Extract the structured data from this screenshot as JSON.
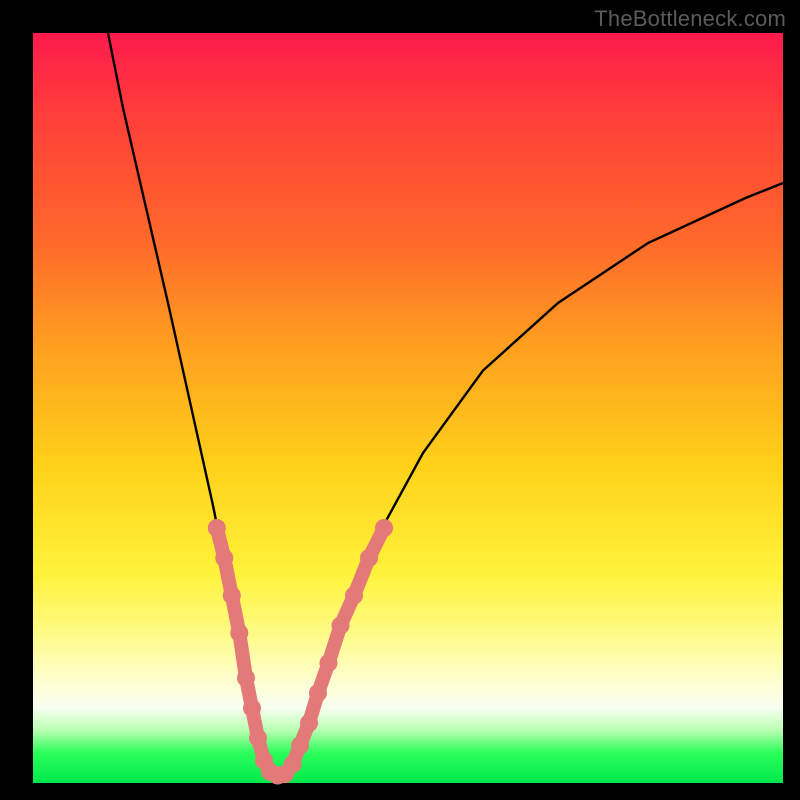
{
  "watermark": "TheBottleneck.com",
  "colors": {
    "frame": "#000000",
    "curve": "#000000",
    "markers": "#e4797a",
    "gradient_top": "#ff1a4d",
    "gradient_bottom": "#00e84c"
  },
  "chart_data": {
    "type": "line",
    "title": "",
    "xlabel": "",
    "ylabel": "",
    "xlim": [
      0,
      100
    ],
    "ylim": [
      0,
      100
    ],
    "grid": false,
    "legend": false,
    "note": "No axis ticks or numeric labels are visible; values are percent of plot width/height estimated from the drawn curve.",
    "series": [
      {
        "name": "curve",
        "x": [
          10,
          12,
          15,
          18,
          20,
          22,
          24,
          26,
          27,
          28,
          29,
          30,
          31,
          32,
          33,
          34,
          35,
          37,
          39,
          42,
          46,
          52,
          60,
          70,
          82,
          95,
          100
        ],
        "y": [
          100,
          90,
          77,
          64,
          55,
          46,
          37,
          27,
          22,
          17,
          11,
          6,
          3,
          1,
          1,
          2,
          5,
          9,
          15,
          23,
          33,
          44,
          55,
          64,
          72,
          78,
          80
        ]
      }
    ],
    "markers": {
      "name": "highlighted-segments",
      "points": [
        {
          "x": 24.5,
          "y": 34
        },
        {
          "x": 25.5,
          "y": 30
        },
        {
          "x": 26.5,
          "y": 25
        },
        {
          "x": 27.5,
          "y": 20
        },
        {
          "x": 28.4,
          "y": 14
        },
        {
          "x": 29.2,
          "y": 10
        },
        {
          "x": 30.0,
          "y": 6
        },
        {
          "x": 30.8,
          "y": 3
        },
        {
          "x": 31.6,
          "y": 1.5
        },
        {
          "x": 32.6,
          "y": 1
        },
        {
          "x": 33.6,
          "y": 1.2
        },
        {
          "x": 34.6,
          "y": 2.5
        },
        {
          "x": 35.6,
          "y": 5
        },
        {
          "x": 36.8,
          "y": 8
        },
        {
          "x": 38.0,
          "y": 12
        },
        {
          "x": 39.4,
          "y": 16
        },
        {
          "x": 41.0,
          "y": 21
        },
        {
          "x": 42.8,
          "y": 25
        },
        {
          "x": 44.8,
          "y": 30
        },
        {
          "x": 46.8,
          "y": 34
        }
      ]
    }
  }
}
